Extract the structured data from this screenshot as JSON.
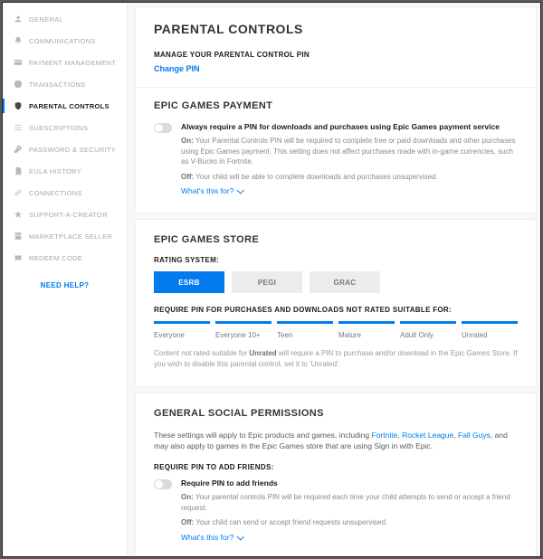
{
  "sidebar": {
    "items": [
      {
        "label": "GENERAL"
      },
      {
        "label": "COMMUNICATIONS"
      },
      {
        "label": "PAYMENT MANAGEMENT"
      },
      {
        "label": "TRANSACTIONS"
      },
      {
        "label": "PARENTAL CONTROLS"
      },
      {
        "label": "SUBSCRIPTIONS"
      },
      {
        "label": "PASSWORD & SECURITY"
      },
      {
        "label": "EULA HISTORY"
      },
      {
        "label": "CONNECTIONS"
      },
      {
        "label": "SUPPORT-A-CREATOR"
      },
      {
        "label": "MARKETPLACE SELLER"
      },
      {
        "label": "REDEEM CODE"
      }
    ],
    "help": "NEED HELP?"
  },
  "header": {
    "title": "PARENTAL CONTROLS",
    "managePin": "MANAGE YOUR PARENTAL CONTROL PIN",
    "changePin": "Change PIN"
  },
  "payment": {
    "heading": "EPIC GAMES PAYMENT",
    "toggleTitle": "Always require a PIN for downloads and purchases using Epic Games payment service",
    "onLabel": "On:",
    "onText": " Your Parental Controls PIN will be required to complete free or paid downloads and other purchases using Epic Games payment. This setting does not affect purchases made with in-game currencies, such as V-Bucks in Fortnite.",
    "offLabel": "Off:",
    "offText": " Your child will be able to complete downloads and purchases unsupervised.",
    "whats": "What's this for?"
  },
  "store": {
    "heading": "EPIC GAMES STORE",
    "ratingLabel": "RATING SYSTEM:",
    "buttons": [
      {
        "label": "ESRB",
        "active": true
      },
      {
        "label": "PEGI",
        "active": false
      },
      {
        "label": "GRAC",
        "active": false
      }
    ],
    "reqLabel": "REQUIRE PIN FOR PURCHASES AND DOWNLOADS NOT RATED SUITABLE FOR:",
    "ages": [
      "Everyone",
      "Everyone 10+",
      "Teen",
      "Mature",
      "Adult Only",
      "Unrated"
    ],
    "noteA": "Content not rated suitable for ",
    "noteB": "Unrated",
    "noteC": " will require a PIN to purchase and/or download in the Epic Games Store. If you wish to disable this parental control, set it to 'Unrated'."
  },
  "social": {
    "heading": "GENERAL SOCIAL PERMISSIONS",
    "introA": "These settings will apply to Epic products and games, including ",
    "link1": "Fortnite",
    "sep": ", ",
    "link2": "Rocket League",
    "link3": "Fall Guys",
    "introB": ", and may also apply to games in the Epic Games store that are using Sign in with Epic.",
    "reqLabel": "REQUIRE PIN TO ADD FRIENDS:",
    "toggleTitle": "Require PIN to add friends",
    "onLabel": "On:",
    "onText": " Your parental controls PIN will be required each time your child attempts to send or accept a friend request.",
    "offLabel": "Off:",
    "offText": " Your child can send or accept friend requests unsupervised.",
    "whats": "What's this for?"
  }
}
